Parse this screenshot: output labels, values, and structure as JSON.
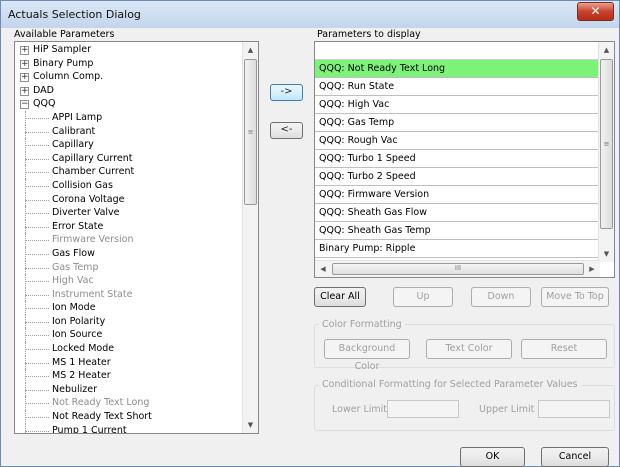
{
  "window": {
    "title": "Actuals Selection Dialog",
    "close_glyph": "✕"
  },
  "available": {
    "label": "Available Parameters",
    "nodes": [
      {
        "label": "HiP Sampler",
        "level": 0,
        "expander": "+"
      },
      {
        "label": "Binary Pump",
        "level": 0,
        "expander": "+"
      },
      {
        "label": "Column Comp.",
        "level": 0,
        "expander": "+"
      },
      {
        "label": "DAD",
        "level": 0,
        "expander": "+"
      },
      {
        "label": "QQQ",
        "level": 0,
        "expander": "−"
      },
      {
        "label": "APPI Lamp",
        "level": 1,
        "disabled": false
      },
      {
        "label": "Calibrant",
        "level": 1,
        "disabled": false
      },
      {
        "label": "Capillary",
        "level": 1,
        "disabled": false
      },
      {
        "label": "Capillary Current",
        "level": 1,
        "disabled": false
      },
      {
        "label": "Chamber Current",
        "level": 1,
        "disabled": false
      },
      {
        "label": "Collision Gas",
        "level": 1,
        "disabled": false
      },
      {
        "label": "Corona Voltage",
        "level": 1,
        "disabled": false
      },
      {
        "label": "Diverter Valve",
        "level": 1,
        "disabled": false
      },
      {
        "label": "Error State",
        "level": 1,
        "disabled": false
      },
      {
        "label": "Firmware Version",
        "level": 1,
        "disabled": true
      },
      {
        "label": "Gas Flow",
        "level": 1,
        "disabled": false
      },
      {
        "label": "Gas Temp",
        "level": 1,
        "disabled": true
      },
      {
        "label": "High Vac",
        "level": 1,
        "disabled": true
      },
      {
        "label": "Instrument State",
        "level": 1,
        "disabled": true
      },
      {
        "label": "Ion Mode",
        "level": 1,
        "disabled": false
      },
      {
        "label": "Ion Polarity",
        "level": 1,
        "disabled": false
      },
      {
        "label": "Ion Source",
        "level": 1,
        "disabled": false
      },
      {
        "label": "Locked Mode",
        "level": 1,
        "disabled": false
      },
      {
        "label": "MS 1 Heater",
        "level": 1,
        "disabled": false
      },
      {
        "label": "MS 2 Heater",
        "level": 1,
        "disabled": false
      },
      {
        "label": "Nebulizer",
        "level": 1,
        "disabled": false
      },
      {
        "label": "Not Ready Text Long",
        "level": 1,
        "disabled": true
      },
      {
        "label": "Not Ready Text Short",
        "level": 1,
        "disabled": false
      },
      {
        "label": "Pump 1 Current",
        "level": 1,
        "disabled": false
      }
    ]
  },
  "move": {
    "add_label": "->",
    "remove_label": "<-"
  },
  "display": {
    "label": "Parameters to display",
    "rows": [
      {
        "text": "QQQ:  Not Ready Text Long",
        "selected": true
      },
      {
        "text": "QQQ:  Run State",
        "selected": false
      },
      {
        "text": "QQQ:  High Vac",
        "selected": false
      },
      {
        "text": "QQQ:  Gas Temp",
        "selected": false
      },
      {
        "text": "QQQ:  Rough Vac",
        "selected": false
      },
      {
        "text": "QQQ:  Turbo 1 Speed",
        "selected": false
      },
      {
        "text": "QQQ:  Turbo 2 Speed",
        "selected": false
      },
      {
        "text": "QQQ:  Firmware Version",
        "selected": false
      },
      {
        "text": "QQQ:  Sheath Gas Flow",
        "selected": false
      },
      {
        "text": "QQQ:  Sheath Gas Temp",
        "selected": false
      },
      {
        "text": "Binary Pump:  Ripple",
        "selected": false
      }
    ]
  },
  "list_buttons": {
    "clear_all": "Clear All",
    "up": "Up",
    "down": "Down",
    "move_to_top": "Move To Top"
  },
  "color_formatting": {
    "label": "Color Formatting",
    "background_color": "Background Color",
    "text_color": "Text Color",
    "reset": "Reset"
  },
  "conditional": {
    "label": "Conditional  Formatting for Selected Parameter Values",
    "lower_limit_label": "Lower Limit",
    "lower_limit_value": "",
    "upper_limit_label": "Upper Limit",
    "upper_limit_value": ""
  },
  "footer": {
    "ok": "OK",
    "cancel": "Cancel"
  },
  "scroll_glyphs": {
    "up": "▲",
    "down": "▼",
    "left": "◀",
    "right": "▶",
    "grip_v": "≡",
    "grip_h": "III"
  },
  "colors": {
    "selected_row": "#7cf278",
    "close_button": "#c7432d"
  }
}
